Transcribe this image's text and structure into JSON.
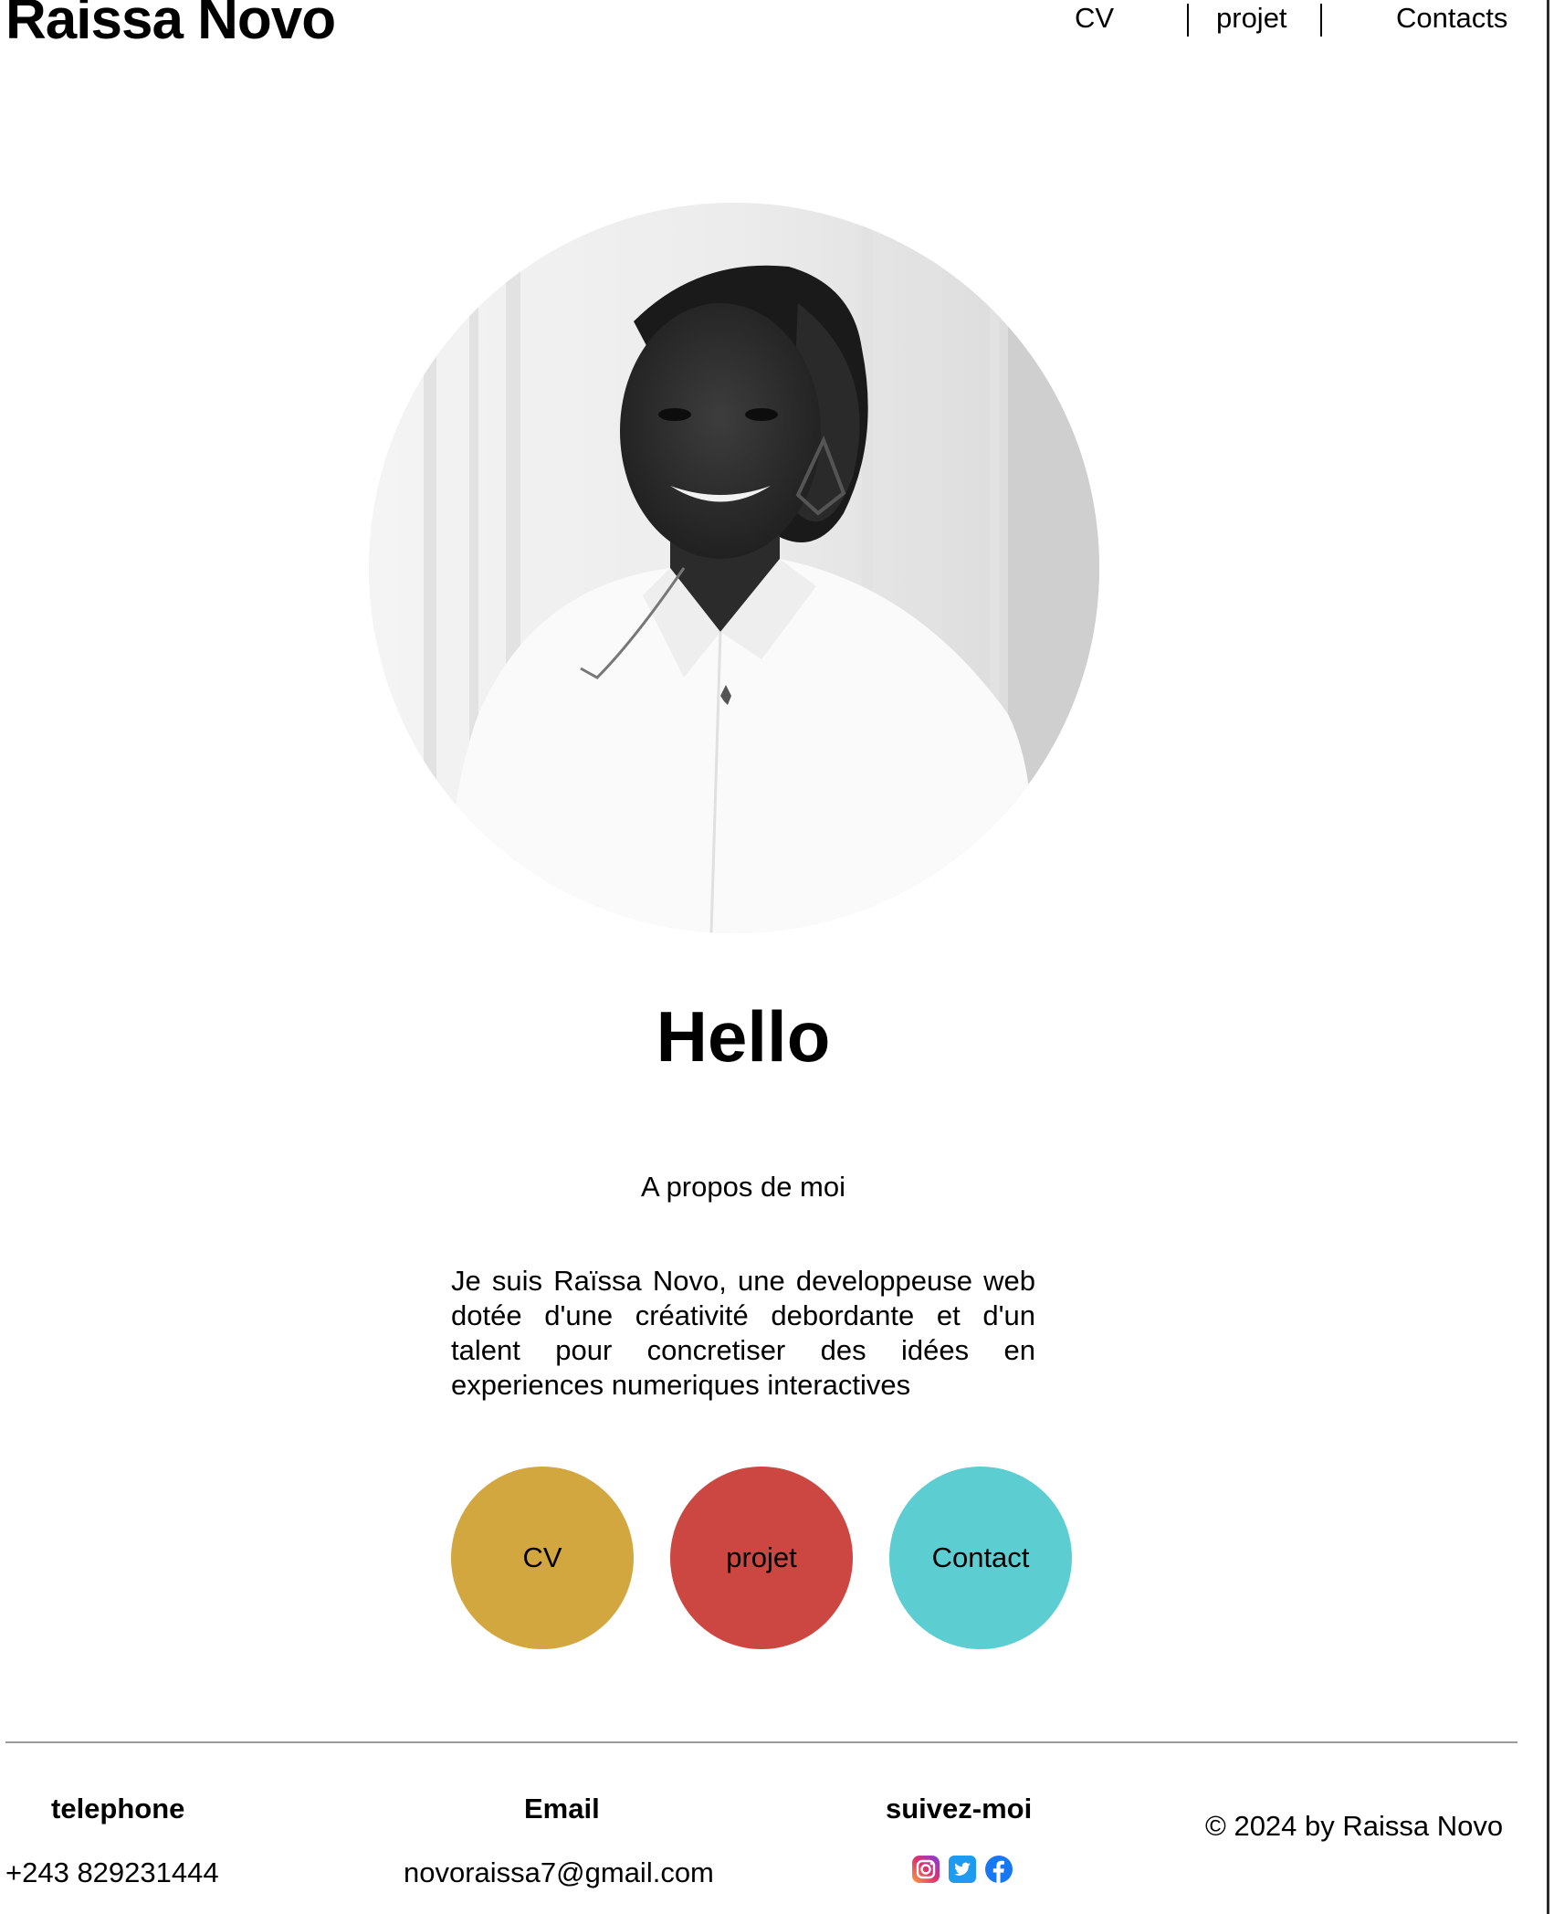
{
  "header": {
    "brand": "Raissa Novo",
    "nav": [
      "CV",
      "projet",
      "Contacts"
    ]
  },
  "hero": {
    "heading": "Hello",
    "about_title": "A propos de moi",
    "about_text": "Je suis Raïssa Novo, une developpeuse web dotée d'une créativité debordante et d'un talent pour concretiser des idées en experiences numeriques interactives"
  },
  "actions": [
    {
      "label": "CV",
      "color": "#d3a73f"
    },
    {
      "label": "projet",
      "color": "#cc4741"
    },
    {
      "label": "Contact",
      "color": "#5ccdd0"
    }
  ],
  "footer": {
    "phone_heading": "telephone",
    "phone_value": "+243 829231444",
    "email_heading": "Email",
    "email_value": "novoraissa7@gmail.com",
    "social_heading": "suivez-moi",
    "social_icons": [
      "instagram-icon",
      "twitter-icon",
      "facebook-icon"
    ],
    "copyright": "© 2024 by Raissa Novo"
  }
}
